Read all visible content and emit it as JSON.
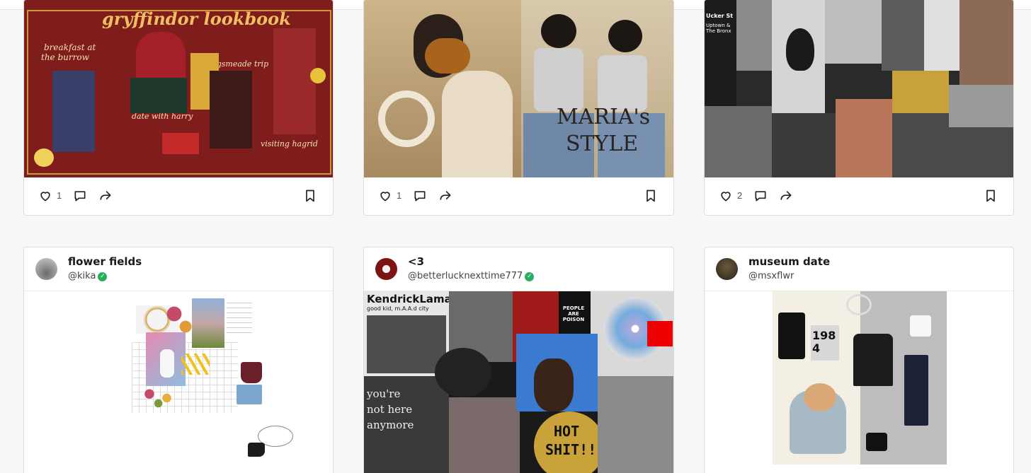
{
  "page": {
    "background": "#f8f8f8",
    "accent_green": "#27ae60"
  },
  "icons": {
    "like": "heart-icon",
    "comment": "comment-icon",
    "share": "share-arrow-icon",
    "save": "bookmark-icon",
    "verified": "verified-badge-icon"
  },
  "posts_top": [
    {
      "like_count": "1",
      "image_text": {
        "title": "gryffindor lookbook",
        "l1": "breakfast at",
        "l2": "the burrow",
        "l3": "hogsmeade trip",
        "l4": "date with harry",
        "l5": "visiting hagrid"
      }
    },
    {
      "like_count": "1",
      "image_text": {
        "title_a": "MARIA's",
        "title_b": "STYLE"
      }
    },
    {
      "like_count": "2",
      "image_text": {
        "t1": "Ucker St",
        "t2": "Uptown & The Bronx"
      }
    }
  ],
  "posts_bottom": [
    {
      "title": "flower fields",
      "handle": "@kika",
      "verified": true
    },
    {
      "title": "<3",
      "handle": "@betterlucknexttime777",
      "verified": true,
      "image_text": {
        "album": "KendrickLamar",
        "album_sub": "good kid, m.A.A.d city",
        "poison": "PEOPLE ARE POISON",
        "hot1": "HOT",
        "hot2": "SHIT!!!",
        "yns1": "you're",
        "yns2": "not here",
        "yns3": "anymore"
      }
    },
    {
      "title": "museum date",
      "handle": "@msxflwr",
      "verified": false,
      "image_text": {
        "book": "1984"
      }
    }
  ]
}
